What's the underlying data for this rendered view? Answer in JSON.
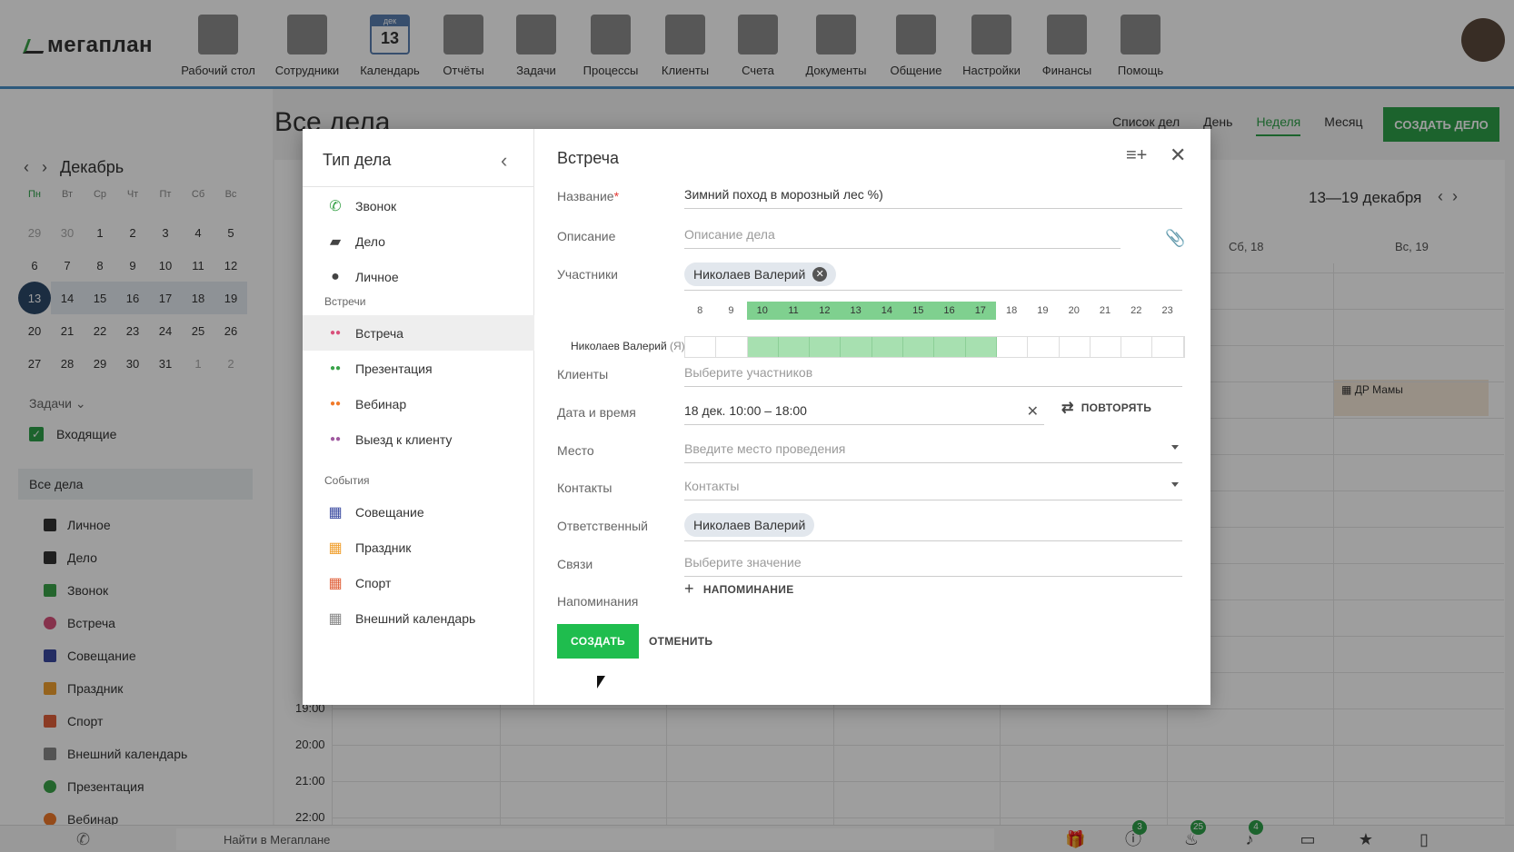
{
  "app": {
    "logo": "мегаплан",
    "modules": [
      {
        "label": "Рабочий стол",
        "icon": "desktop-icon"
      },
      {
        "label": "Сотрудники",
        "icon": "employees-icon"
      },
      {
        "label": "Календарь",
        "icon": "calendar-icon",
        "month": "дек",
        "day": "13"
      },
      {
        "label": "Отчёты",
        "icon": "reports-icon"
      },
      {
        "label": "Задачи",
        "icon": "tasks-icon"
      },
      {
        "label": "Процессы",
        "icon": "processes-icon"
      },
      {
        "label": "Клиенты",
        "icon": "clients-icon"
      },
      {
        "label": "Счета",
        "icon": "invoices-icon"
      },
      {
        "label": "Документы",
        "icon": "documents-icon"
      },
      {
        "label": "Общение",
        "icon": "chat-icon"
      },
      {
        "label": "Настройки",
        "icon": "settings-icon"
      },
      {
        "label": "Финансы",
        "icon": "finance-icon"
      },
      {
        "label": "Помощь",
        "icon": "help-icon"
      }
    ]
  },
  "sidebar": {
    "month": "Декабрь",
    "weekdays": [
      "Пн",
      "Вт",
      "Ср",
      "Чт",
      "Пт",
      "Сб",
      "Вс"
    ],
    "days": [
      [
        "29",
        "30",
        "1",
        "2",
        "3",
        "4",
        "5"
      ],
      [
        "6",
        "7",
        "8",
        "9",
        "10",
        "11",
        "12"
      ],
      [
        "13",
        "14",
        "15",
        "16",
        "17",
        "18",
        "19"
      ],
      [
        "20",
        "21",
        "22",
        "23",
        "24",
        "25",
        "26"
      ],
      [
        "27",
        "28",
        "29",
        "30",
        "31",
        "1",
        "2"
      ]
    ],
    "tasks_label": "Задачи",
    "inbox_label": "Входящие",
    "all_tasks_label": "Все дела",
    "list": [
      "Личное",
      "Дело",
      "Звонок",
      "Встреча",
      "Совещание",
      "Праздник",
      "Спорт",
      "Внешний календарь",
      "Презентация",
      "Вебинар"
    ]
  },
  "main": {
    "title": "Все дела",
    "views": [
      "Список дел",
      "День",
      "Неделя",
      "Месяц"
    ],
    "active_view": "Неделя",
    "create_button": "СОЗДАТЬ ДЕЛО",
    "range": "13—19 декабря",
    "day_heads": [
      "Сб, 18",
      "Вс, 19"
    ],
    "event": "ДР Мамы",
    "times": [
      "19:00",
      "20:00",
      "21:00",
      "22:00"
    ]
  },
  "bottombar": {
    "search": "Найти в Мегаплане",
    "badges": {
      "alerts": "3",
      "hot": "25",
      "notifications": "4"
    }
  },
  "modal": {
    "types_title": "Тип дела",
    "types_top": [
      {
        "label": "Звонок",
        "icon": "phone-icon",
        "color": "#3aa34a"
      },
      {
        "label": "Дело",
        "icon": "briefcase-icon",
        "color": "#444444"
      },
      {
        "label": "Личное",
        "icon": "person-icon",
        "color": "#444444"
      }
    ],
    "group_meetings": "Встречи",
    "types_meetings": [
      {
        "label": "Встреча",
        "icon": "people-icon",
        "color": "#d9517b"
      },
      {
        "label": "Презентация",
        "icon": "people-icon",
        "color": "#3aa34a"
      },
      {
        "label": "Вебинар",
        "icon": "people-icon",
        "color": "#f07a2a"
      },
      {
        "label": "Выезд к клиенту",
        "icon": "people-icon",
        "color": "#a05aa0"
      }
    ],
    "group_events": "События",
    "types_events": [
      {
        "label": "Совещание",
        "icon": "calendar-icon",
        "color": "#3a4aa0"
      },
      {
        "label": "Праздник",
        "icon": "calendar-icon",
        "color": "#f0a030"
      },
      {
        "label": "Спорт",
        "icon": "calendar-icon",
        "color": "#e0603a"
      },
      {
        "label": "Внешний календарь",
        "icon": "calendar-icon",
        "color": "#888888"
      }
    ],
    "form_title": "Встреча",
    "fields": {
      "name_label": "Название",
      "name_value": "Зимний поход в морозный лес %)",
      "desc_label": "Описание",
      "desc_placeholder": "Описание дела",
      "participants_label": "Участники",
      "participant": "Николаев Валерий",
      "clients_label": "Клиенты",
      "clients_placeholder": "Выберите участников",
      "datetime_label": "Дата и время",
      "datetime_value": "18 дек. 10:00 – 18:00",
      "repeat_label": "ПОВТОРЯТЬ",
      "place_label": "Место",
      "place_placeholder": "Введите место проведения",
      "contacts_label": "Контакты",
      "contacts_placeholder": "Контакты",
      "responsible_label": "Ответственный",
      "responsible": "Николаев Валерий",
      "links_label": "Связи",
      "links_placeholder": "Выберите значение",
      "reminders_label": "Напоминания",
      "add_reminder": "НАПОМИНАНИЕ"
    },
    "timeline": {
      "hours": [
        "8",
        "9",
        "10",
        "11",
        "12",
        "13",
        "14",
        "15",
        "16",
        "17",
        "18",
        "19",
        "20",
        "21",
        "22",
        "23"
      ],
      "busy_from": "10",
      "busy_to": "17",
      "person": "Николаев Валерий",
      "me_mark": "(Я)"
    },
    "create_button": "СОЗДАТЬ",
    "cancel_button": "ОТМЕНИТЬ"
  }
}
